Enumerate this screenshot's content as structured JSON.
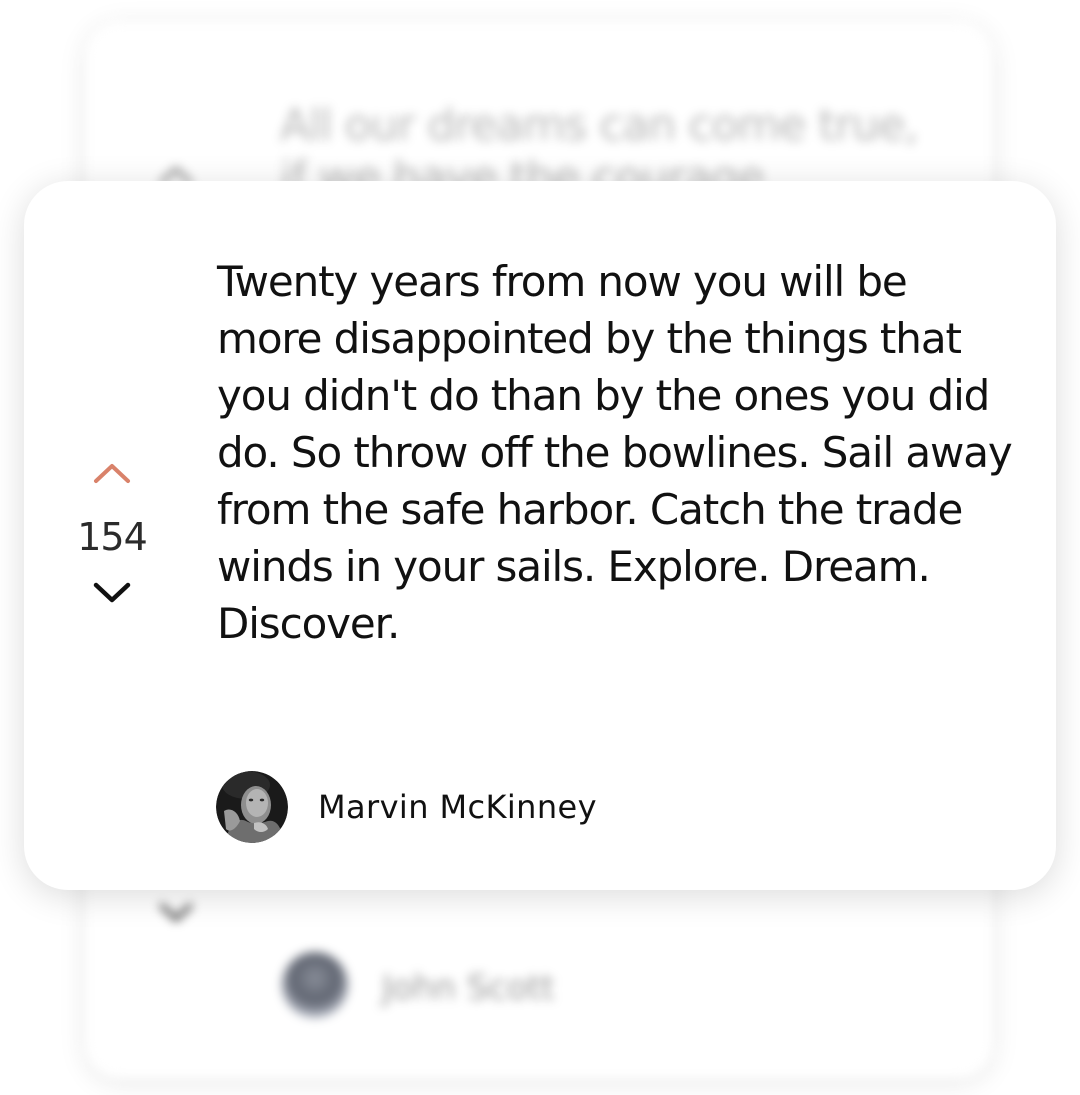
{
  "background_card": {
    "quote": "All our dreams can come true, if we have the courage",
    "author": "John Scott",
    "avatar_icon": "user-avatar"
  },
  "quote_card": {
    "vote": {
      "count": "154",
      "upvote_icon": "chevron-up-icon",
      "downvote_icon": "chevron-down-icon",
      "upvote_color": "#d9826a",
      "downvote_color": "#111111"
    },
    "quote": "Twenty years from now you will be more disappointed by the things that you didn't do than by the ones you did do. So throw off the bowlines. Sail away from the safe harbor. Catch the trade winds in your sails. Explore. Dream. Discover.",
    "author": {
      "name": "Marvin McKinney",
      "avatar_icon": "user-avatar"
    }
  }
}
